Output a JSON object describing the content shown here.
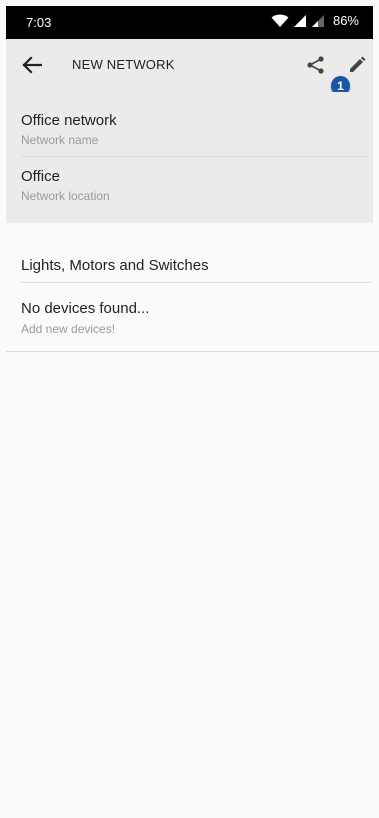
{
  "status_bar": {
    "time": "7:03",
    "battery": "86%",
    "icons": [
      "wifi-icon",
      "signal-icon",
      "signal-weak-icon"
    ]
  },
  "toolbar": {
    "title": "NEW NETWORK",
    "badge_count": "1",
    "icons": [
      "back-arrow-icon",
      "share-icon",
      "edit-pencil-icon"
    ]
  },
  "network": {
    "name_value": "Office network",
    "name_label": "Network name",
    "location_value": "Office",
    "location_label": "Network location"
  },
  "devices": {
    "section_title": "Lights, Motors and Switches",
    "empty_title": "No devices found...",
    "empty_subtitle": "Add new devices!"
  },
  "colors": {
    "status_bar_bg": "#000000",
    "header_bg": "#ebebeb",
    "page_bg": "#fafafa",
    "badge_bg": "#1a56a6",
    "secondary_text": "#9a9a9a"
  }
}
